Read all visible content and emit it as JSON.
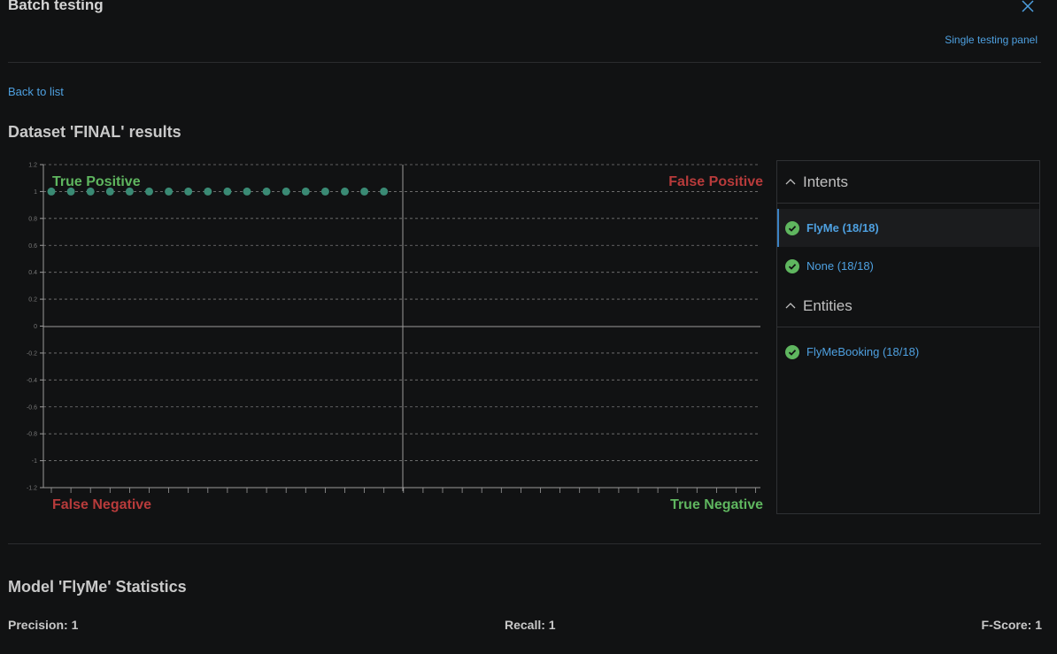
{
  "header": {
    "title": "Batch testing",
    "single_testing_link": "Single testing panel"
  },
  "nav": {
    "back_link": "Back to list"
  },
  "dataset_title": "Dataset 'FINAL' results",
  "colors": {
    "positive": "#5fb65f",
    "negative": "#b83b3b",
    "link": "#4ea0e0",
    "point": "#3a8a74"
  },
  "chart_data": {
    "type": "scatter",
    "quadrant_labels": {
      "top_left": "True Positive",
      "top_right": "False Positive",
      "bottom_left": "False Negative",
      "bottom_right": "True Negative"
    },
    "yticks": [
      "1.2",
      "1",
      "0.8",
      "0.6",
      "0.4",
      "0.2",
      "0",
      "-0.2",
      "-0.4",
      "-0.6",
      "-0.8",
      "-1",
      "-1.2"
    ],
    "ylim": [
      -1.2,
      1.2
    ],
    "grid": true,
    "points": [
      {
        "x": 1,
        "y": 1
      },
      {
        "x": 2,
        "y": 1
      },
      {
        "x": 3,
        "y": 1
      },
      {
        "x": 4,
        "y": 1
      },
      {
        "x": 5,
        "y": 1
      },
      {
        "x": 6,
        "y": 1
      },
      {
        "x": 7,
        "y": 1
      },
      {
        "x": 8,
        "y": 1
      },
      {
        "x": 9,
        "y": 1
      },
      {
        "x": 10,
        "y": 1
      },
      {
        "x": 11,
        "y": 1
      },
      {
        "x": 12,
        "y": 1
      },
      {
        "x": 13,
        "y": 1
      },
      {
        "x": 14,
        "y": 1
      },
      {
        "x": 15,
        "y": 1
      },
      {
        "x": 16,
        "y": 1
      },
      {
        "x": 17,
        "y": 1
      },
      {
        "x": 18,
        "y": 1
      }
    ]
  },
  "panel": {
    "intents_header": "Intents",
    "intents": [
      {
        "label": "FlyMe (18/18)",
        "status": "check-icon",
        "selected": true
      },
      {
        "label": "None (18/18)",
        "status": "check-icon",
        "selected": false
      }
    ],
    "entities_header": "Entities",
    "entities": [
      {
        "label": "FlyMeBooking (18/18)",
        "status": "check-icon",
        "selected": false
      }
    ]
  },
  "model_stats": {
    "title": "Model 'FlyMe' Statistics",
    "precision": "Precision: 1",
    "recall": "Recall: 1",
    "fscore": "F-Score: 1"
  }
}
